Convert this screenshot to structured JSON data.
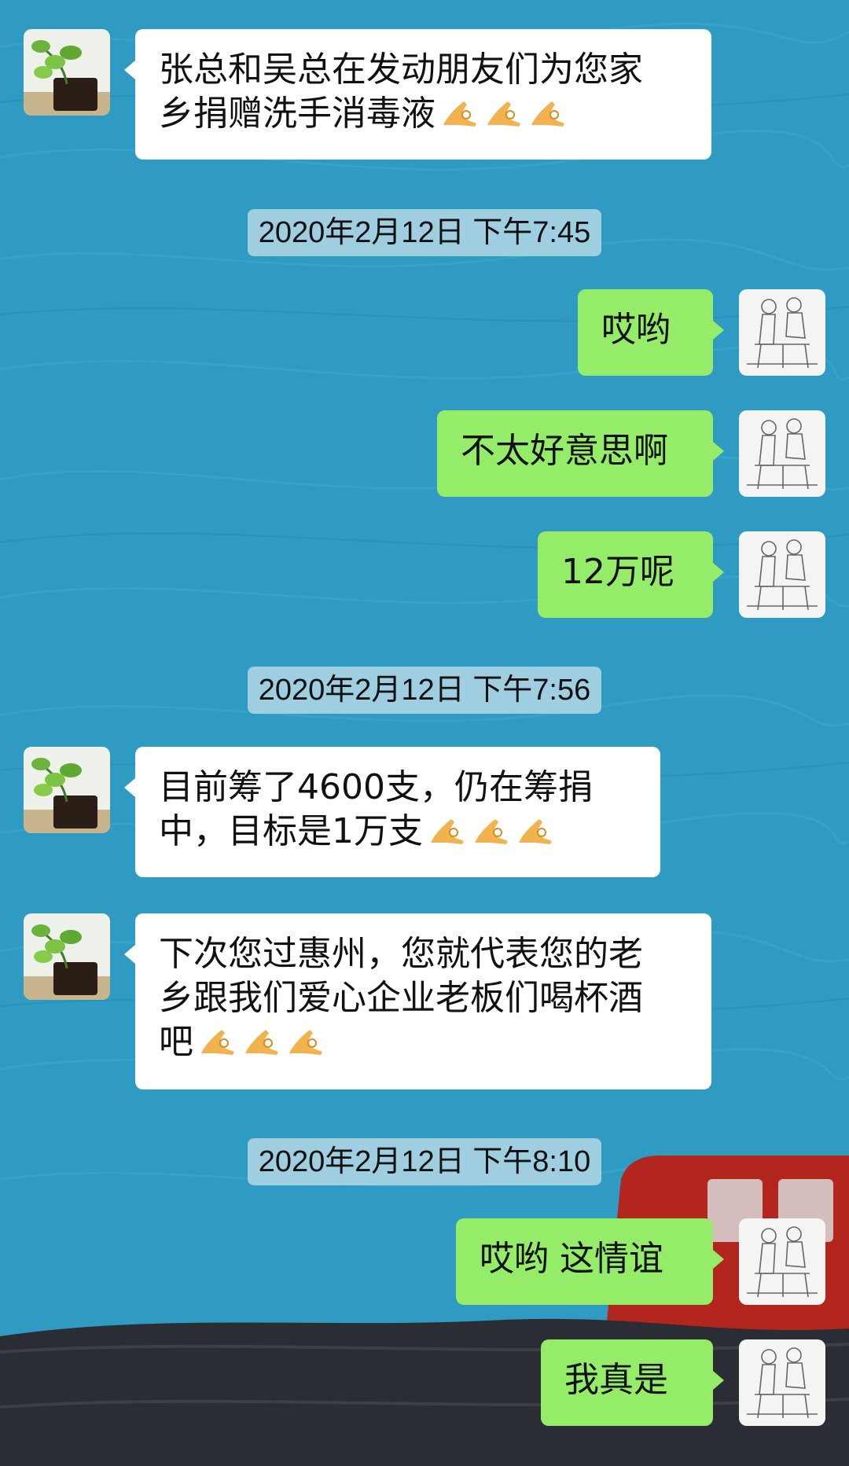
{
  "colors": {
    "background": "#2f9ac2",
    "incoming_bubble": "#ffffff",
    "outgoing_bubble": "#95ec69",
    "timestamp_pill": "#bedce8"
  },
  "messages": {
    "m1": {
      "line1": "张总和吴总在发动朋友们为您家",
      "line2": "乡捐赠洗手消毒液",
      "emoji": "ok-hand-icon"
    },
    "ts1": "2020年2月12日 下午7:45",
    "m2": {
      "text": "哎哟"
    },
    "m3": {
      "text": "不太好意思啊"
    },
    "m4": {
      "text": "12万呢"
    },
    "ts2": "2020年2月12日 下午7:56",
    "m5": {
      "line1": "目前筹了4600支，仍在筹捐",
      "line2": "中，目标是1万支",
      "emoji": "ok-hand-icon"
    },
    "m6": {
      "line1": "下次您过惠州，您就代表您的老",
      "line2": "乡跟我们爱心企业老板们喝杯酒",
      "line3": "吧",
      "emoji": "ok-hand-icon"
    },
    "ts3": "2020年2月12日 下午8:10",
    "m7": {
      "text": "哎哟 这情谊"
    },
    "m8": {
      "text": "我真是"
    }
  },
  "avatars": {
    "incoming": "plant-avatar",
    "outgoing": "sketch-avatar"
  }
}
